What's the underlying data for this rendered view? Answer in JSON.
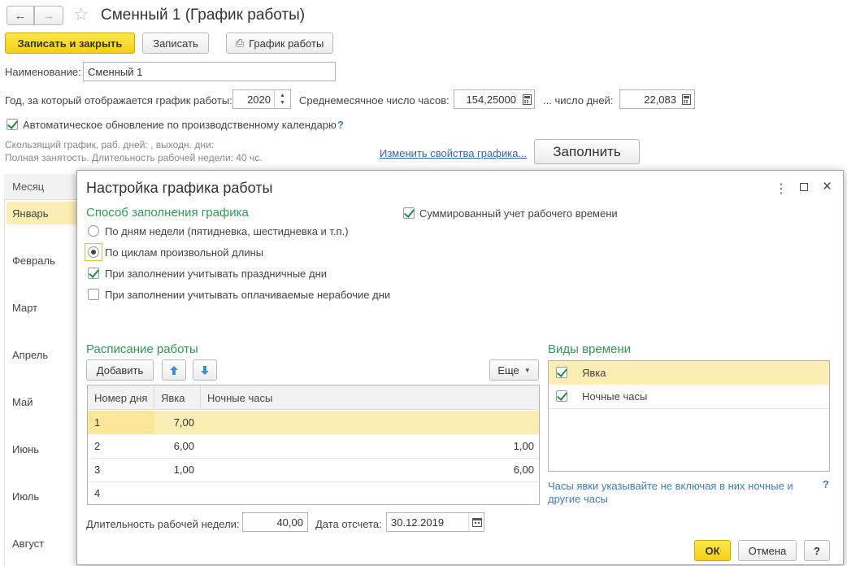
{
  "window": {
    "title": "Сменный 1 (График работы)"
  },
  "toolbar": {
    "save_close": "Записать и закрыть",
    "save": "Записать",
    "schedule": "График работы"
  },
  "form": {
    "name_label": "Наименование:",
    "name_value": "Сменный 1",
    "year_label": "Год, за который отображается график работы:",
    "year_value": "2020",
    "avg_hours_label": "Среднемесячное число часов:",
    "avg_hours_value": "154,25000",
    "days_label": "... число дней:",
    "days_value": "22,083",
    "auto_update_label": "Автоматическое обновление по производственному календарю",
    "help": "?",
    "info_line1": "Скользящий график, раб. дней: , выходн. дни:",
    "info_line2": "Полная занятость. Длительность рабочей недели: 40 чс.",
    "change_link": "Изменить свойства графика...",
    "fill_button": "Заполнить"
  },
  "months": {
    "header": "Месяц",
    "items": [
      "Январь",
      "Февраль",
      "Март",
      "Апрель",
      "Май",
      "Июнь",
      "Июль",
      "Август"
    ]
  },
  "dialog": {
    "title": "Настройка графика работы",
    "fill_method_title": "Способ заполнения графика",
    "opt_weekdays": "По дням недели (пятидневка, шестидневка и т.п.)",
    "opt_cycles": "По циклам произвольной длины",
    "chk_holidays": "При заполнении учитывать праздничные дни",
    "chk_paid_nonwork": "При заполнении учитывать оплачиваемые нерабочие дни",
    "chk_summed": "Суммированный учет рабочего времени",
    "schedule_title": "Расписание работы",
    "add_button": "Добавить",
    "more_button": "Еще",
    "columns": [
      "Номер дня",
      "Явка",
      "Ночные часы"
    ],
    "rows": [
      {
        "day": "1",
        "attend": "7,00",
        "night": ""
      },
      {
        "day": "2",
        "attend": "6,00",
        "night": "1,00"
      },
      {
        "day": "3",
        "attend": "1,00",
        "night": "6,00"
      },
      {
        "day": "4",
        "attend": "",
        "night": ""
      }
    ],
    "time_types_title": "Виды времени",
    "time_types": [
      "Явка",
      "Ночные часы"
    ],
    "hint": "Часы явки указывайте не включая в них ночные и другие часы",
    "hint_help": "?",
    "week_len_label": "Длительность рабочей недели:",
    "week_len_value": "40,00",
    "ref_date_label": "Дата отсчета:",
    "ref_date_value": "30.12.2019",
    "ok": "ОК",
    "cancel": "Отмена",
    "help": "?"
  }
}
